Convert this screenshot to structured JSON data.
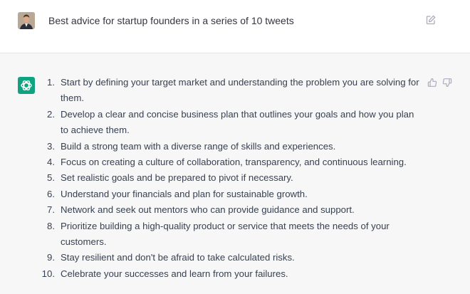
{
  "user_message": {
    "text": "Best advice for startup founders in a series of 10 tweets"
  },
  "icons": {
    "edit": "edit-icon",
    "thumbs_up": "thumbs-up-icon",
    "thumbs_down": "thumbs-down-icon",
    "assistant": "openai-logo-icon",
    "user": "user-avatar"
  },
  "colors": {
    "assistant_avatar_bg": "#10a37f",
    "assistant_row_bg": "#f7f7f8",
    "user_row_bg": "#ffffff"
  },
  "assistant_message": {
    "items": [
      {
        "num": "1.",
        "text": "Start by defining your target market and understanding the problem you are solving for them."
      },
      {
        "num": "2.",
        "text": "Develop a clear and concise business plan that outlines your goals and how you plan to achieve them."
      },
      {
        "num": "3.",
        "text": "Build a strong team with a diverse range of skills and experiences."
      },
      {
        "num": "4.",
        "text": "Focus on creating a culture of collaboration, transparency, and continuous learning."
      },
      {
        "num": "5.",
        "text": "Set realistic goals and be prepared to pivot if necessary."
      },
      {
        "num": "6.",
        "text": "Understand your financials and plan for sustainable growth."
      },
      {
        "num": "7.",
        "text": "Network and seek out mentors who can provide guidance and support."
      },
      {
        "num": "8.",
        "text": "Prioritize building a high-quality product or service that meets the needs of your customers."
      },
      {
        "num": "9.",
        "text": "Stay resilient and don't be afraid to take calculated risks."
      },
      {
        "num": "10.",
        "text": "Celebrate your successes and learn from your failures."
      }
    ]
  }
}
